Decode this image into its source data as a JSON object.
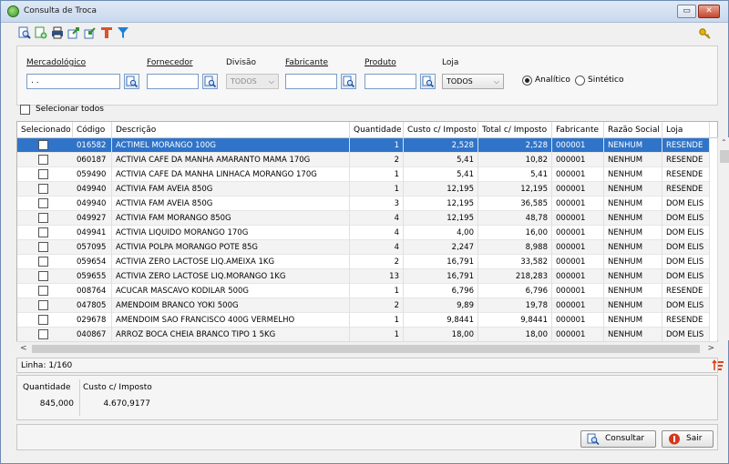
{
  "window": {
    "title": "Consulta de Troca",
    "min_label": "▭",
    "close_label": "✕"
  },
  "toolbar": {
    "icons": [
      "search-doc-icon",
      "new-doc-icon",
      "print-icon",
      "export-icon",
      "import-icon",
      "text-tool-icon",
      "filter-icon"
    ],
    "key_icon": "key-icon"
  },
  "filters": {
    "mercadologico_label": "Mercadológico",
    "mercadologico_value": " .  .",
    "fornecedor_label": "Fornecedor",
    "fornecedor_value": "",
    "divisao_label": "Divisão",
    "divisao_value": "TODOS",
    "fabricante_label": "Fabricante",
    "fabricante_value": "",
    "produto_label": "Produto",
    "produto_value": "",
    "loja_label": "Loja",
    "loja_value": "TODOS",
    "analitico_label": "Analítico",
    "sintetico_label": "Sintético",
    "mode_selected": "Analítico"
  },
  "select_all_label": "Selecionar todos",
  "grid": {
    "headers": [
      "Selecionado",
      "Código",
      "Descrição",
      "Quantidade",
      "Custo c/ Imposto",
      "Total c/ Imposto",
      "Fabricante",
      "Razão Social",
      "Loja"
    ],
    "rows": [
      {
        "codigo": "016582",
        "descricao": "ACTIMEL MORANGO 100G",
        "quantidade": "1",
        "custo": "2,528",
        "total": "2,528",
        "fabricante": "000001",
        "razao": "NENHUM",
        "loja": "RESENDE"
      },
      {
        "codigo": "060187",
        "descricao": "ACTIVIA CAFE DA MANHA AMARANTO MAMA 170G",
        "quantidade": "2",
        "custo": "5,41",
        "total": "10,82",
        "fabricante": "000001",
        "razao": "NENHUM",
        "loja": "RESENDE"
      },
      {
        "codigo": "059490",
        "descricao": "ACTIVIA CAFE DA MANHA LINHACA MORANGO 170G",
        "quantidade": "1",
        "custo": "5,41",
        "total": "5,41",
        "fabricante": "000001",
        "razao": "NENHUM",
        "loja": "RESENDE"
      },
      {
        "codigo": "049940",
        "descricao": "ACTIVIA FAM AVEIA 850G",
        "quantidade": "1",
        "custo": "12,195",
        "total": "12,195",
        "fabricante": "000001",
        "razao": "NENHUM",
        "loja": "RESENDE"
      },
      {
        "codigo": "049940",
        "descricao": "ACTIVIA FAM AVEIA 850G",
        "quantidade": "3",
        "custo": "12,195",
        "total": "36,585",
        "fabricante": "000001",
        "razao": "NENHUM",
        "loja": "DOM ELIS"
      },
      {
        "codigo": "049927",
        "descricao": "ACTIVIA FAM MORANGO 850G",
        "quantidade": "4",
        "custo": "12,195",
        "total": "48,78",
        "fabricante": "000001",
        "razao": "NENHUM",
        "loja": "DOM ELIS"
      },
      {
        "codigo": "049941",
        "descricao": "ACTIVIA LIQUIDO MORANGO 170G",
        "quantidade": "4",
        "custo": "4,00",
        "total": "16,00",
        "fabricante": "000001",
        "razao": "NENHUM",
        "loja": "DOM ELIS"
      },
      {
        "codigo": "057095",
        "descricao": "ACTIVIA POLPA MORANGO POTE 85G",
        "quantidade": "4",
        "custo": "2,247",
        "total": "8,988",
        "fabricante": "000001",
        "razao": "NENHUM",
        "loja": "DOM ELIS"
      },
      {
        "codigo": "059654",
        "descricao": "ACTIVIA ZERO LACTOSE LIQ.AMEIXA 1KG",
        "quantidade": "2",
        "custo": "16,791",
        "total": "33,582",
        "fabricante": "000001",
        "razao": "NENHUM",
        "loja": "DOM ELIS"
      },
      {
        "codigo": "059655",
        "descricao": "ACTIVIA ZERO LACTOSE LIQ.MORANGO 1KG",
        "quantidade": "13",
        "custo": "16,791",
        "total": "218,283",
        "fabricante": "000001",
        "razao": "NENHUM",
        "loja": "DOM ELIS"
      },
      {
        "codigo": "008764",
        "descricao": "ACUCAR MASCAVO KODILAR 500G",
        "quantidade": "1",
        "custo": "6,796",
        "total": "6,796",
        "fabricante": "000001",
        "razao": "NENHUM",
        "loja": "RESENDE"
      },
      {
        "codigo": "047805",
        "descricao": "AMENDOIM BRANCO YOKI 500G",
        "quantidade": "2",
        "custo": "9,89",
        "total": "19,78",
        "fabricante": "000001",
        "razao": "NENHUM",
        "loja": "DOM ELIS"
      },
      {
        "codigo": "029678",
        "descricao": "AMENDOIM SAO FRANCISCO 400G VERMELHO",
        "quantidade": "1",
        "custo": "9,8441",
        "total": "9,8441",
        "fabricante": "000001",
        "razao": "NENHUM",
        "loja": "RESENDE"
      },
      {
        "codigo": "040867",
        "descricao": "ARROZ BOCA CHEIA BRANCO TIPO 1 5KG",
        "quantidade": "1",
        "custo": "18,00",
        "total": "18,00",
        "fabricante": "000001",
        "razao": "NENHUM",
        "loja": "DOM ELIS"
      }
    ]
  },
  "status": {
    "linha": "Linha: 1/160"
  },
  "totals": {
    "quantidade_label": "Quantidade",
    "custo_label": "Custo c/ Imposto",
    "quantidade_value": "845,000",
    "custo_value": "4.670,9177"
  },
  "buttons": {
    "consultar": "Consultar",
    "sair": "Sair"
  },
  "colors": {
    "selection": "#2f74c9",
    "accent_link": "#1a4fa0"
  }
}
